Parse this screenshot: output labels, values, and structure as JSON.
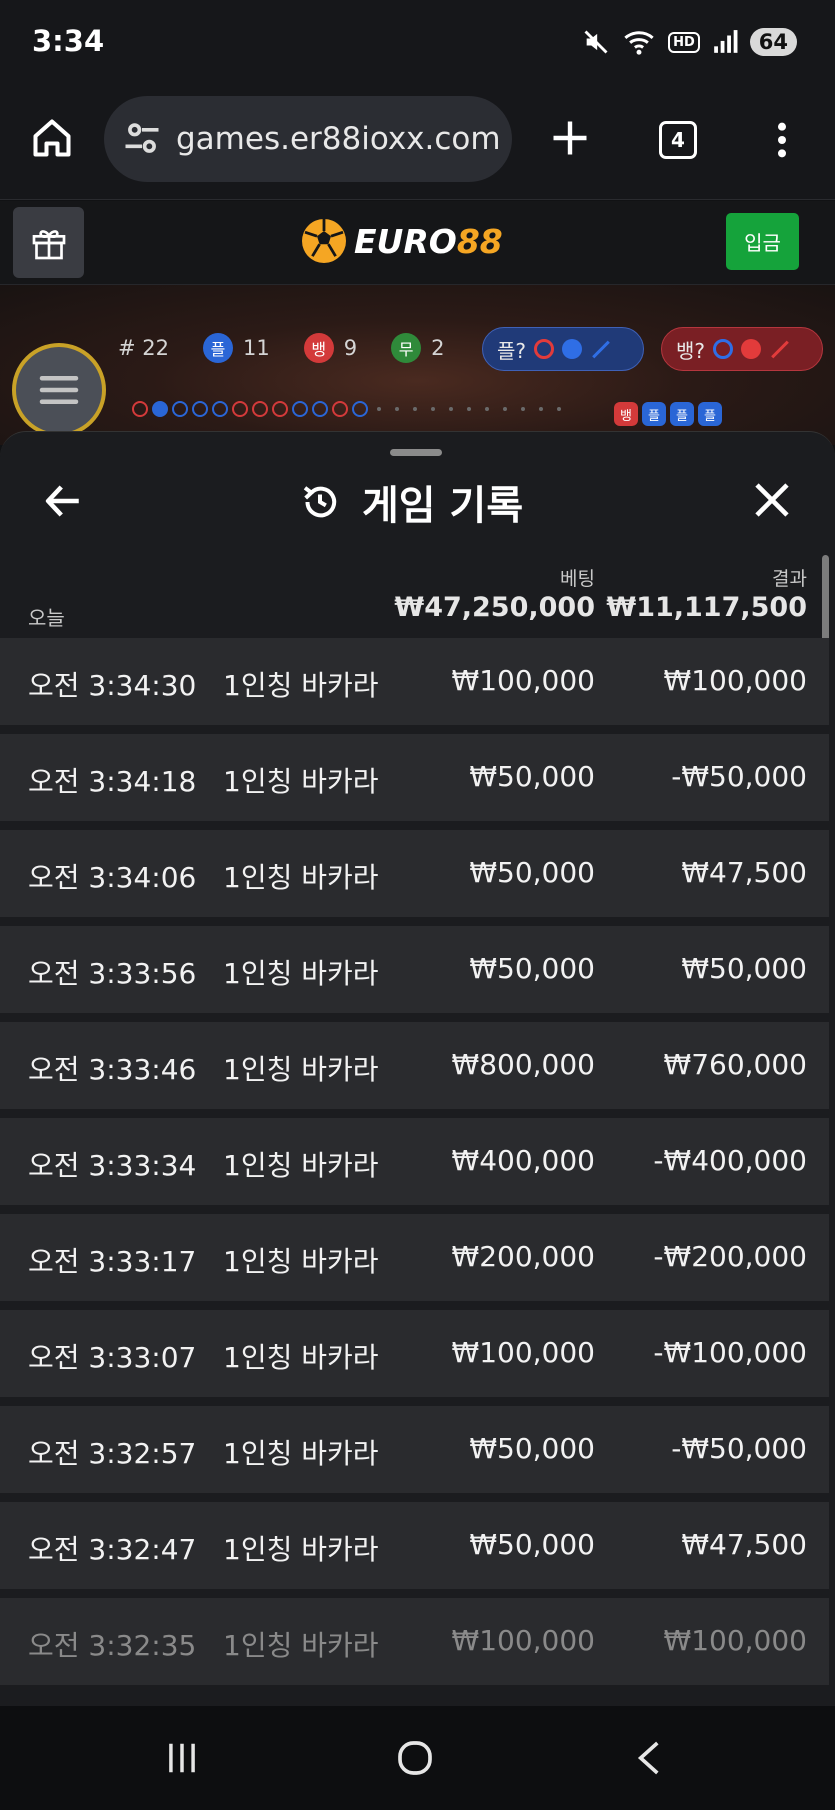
{
  "status_bar": {
    "time": "3:34",
    "battery": "64",
    "hd_label": "HD"
  },
  "browser": {
    "url": "games.er88ioxx.com",
    "tab_count": "4"
  },
  "site_header": {
    "logo_part1": "EURO",
    "logo_part2": "88",
    "deposit_label": "입금"
  },
  "game_strip": {
    "round_label": "# 22",
    "player_badge": "플",
    "player_count": "11",
    "banker_badge": "뱅",
    "banker_count": "9",
    "tie_badge": "무",
    "tie_count": "2",
    "player_predict_label": "플?",
    "banker_predict_label": "뱅?",
    "mini_tags": [
      "뱅",
      "플",
      "플",
      "플"
    ]
  },
  "sheet": {
    "title": "게임 기록",
    "today_label": "오늘",
    "bet_header": "베팅",
    "result_header": "결과",
    "total_bet": "₩47,250,000",
    "total_result": "₩11,117,500",
    "rows": [
      {
        "time": "오전 3:34:30",
        "game": "1인칭 바카라",
        "bet": "₩100,000",
        "result": "₩100,000"
      },
      {
        "time": "오전 3:34:18",
        "game": "1인칭 바카라",
        "bet": "₩50,000",
        "result": "-₩50,000"
      },
      {
        "time": "오전 3:34:06",
        "game": "1인칭 바카라",
        "bet": "₩50,000",
        "result": "₩47,500"
      },
      {
        "time": "오전 3:33:56",
        "game": "1인칭 바카라",
        "bet": "₩50,000",
        "result": "₩50,000"
      },
      {
        "time": "오전 3:33:46",
        "game": "1인칭 바카라",
        "bet": "₩800,000",
        "result": "₩760,000"
      },
      {
        "time": "오전 3:33:34",
        "game": "1인칭 바카라",
        "bet": "₩400,000",
        "result": "-₩400,000"
      },
      {
        "time": "오전 3:33:17",
        "game": "1인칭 바카라",
        "bet": "₩200,000",
        "result": "-₩200,000"
      },
      {
        "time": "오전 3:33:07",
        "game": "1인칭 바카라",
        "bet": "₩100,000",
        "result": "-₩100,000"
      },
      {
        "time": "오전 3:32:57",
        "game": "1인칭 바카라",
        "bet": "₩50,000",
        "result": "-₩50,000"
      },
      {
        "time": "오전 3:32:47",
        "game": "1인칭 바카라",
        "bet": "₩50,000",
        "result": "₩47,500"
      },
      {
        "time": "오전 3:32:35",
        "game": "1인칭 바카라",
        "bet": "₩100,000",
        "result": "₩100,000"
      }
    ]
  },
  "colors": {
    "player_blue": "#2a66d6",
    "banker_red": "#d33a3a",
    "tie_green": "#2f8a3a",
    "deposit_green": "#15a33b",
    "logo_gold": "#f5a623"
  },
  "icons": {
    "status": [
      "mute-icon",
      "wifi-icon",
      "hd-icon",
      "signal-icon"
    ],
    "browser": [
      "home-icon",
      "site-settings-icon",
      "plus-icon",
      "tabs-icon",
      "more-vert-icon"
    ],
    "sheet": [
      "back-arrow-icon",
      "history-icon",
      "close-icon"
    ],
    "nav": [
      "recent-apps-icon",
      "home-circle-icon",
      "nav-back-icon"
    ]
  }
}
